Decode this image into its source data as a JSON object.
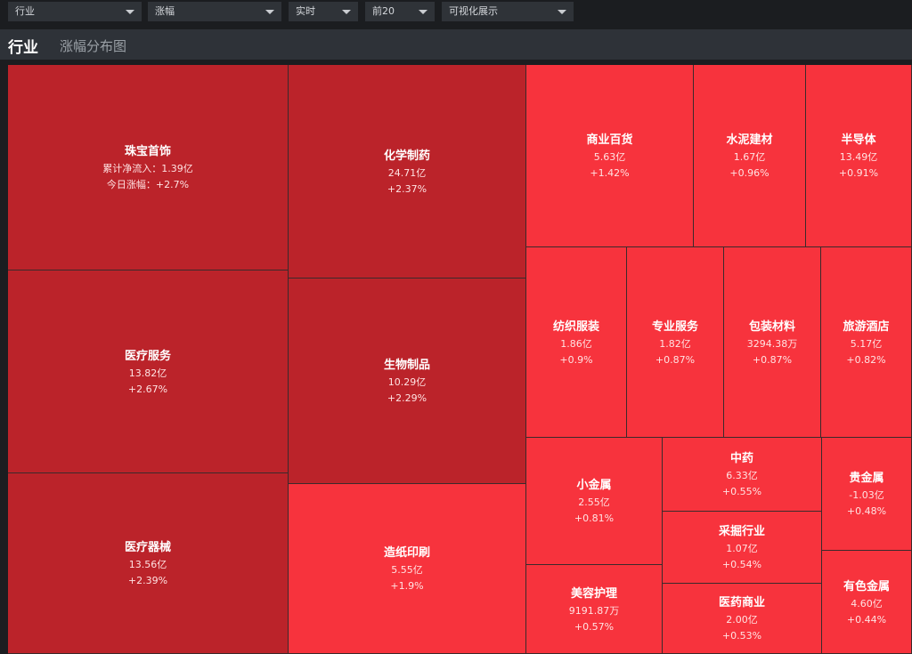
{
  "toolbar": {
    "selects": [
      {
        "value": "行业"
      },
      {
        "value": "涨幅"
      },
      {
        "value": "实时"
      },
      {
        "value": "前20"
      },
      {
        "value": "可视化展示"
      }
    ]
  },
  "header": {
    "title": "行业",
    "subtitle": "涨幅分布图"
  },
  "colors": {
    "dark_tile": "#bb232a",
    "bright_tile": "#f7333d",
    "background": "#1b1d20",
    "title_bar": "#2e3238"
  },
  "treemap": {
    "items": [
      {
        "name": "珠宝首饰",
        "flow": "累计净流入：1.39亿",
        "change": "今日涨幅：+2.7%",
        "shade": "dark"
      },
      {
        "name": "化学制药",
        "flow": "24.71亿",
        "change": "+2.37%",
        "shade": "dark"
      },
      {
        "name": "医疗服务",
        "flow": "13.82亿",
        "change": "+2.67%",
        "shade": "dark"
      },
      {
        "name": "生物制品",
        "flow": "10.29亿",
        "change": "+2.29%",
        "shade": "dark"
      },
      {
        "name": "医疗器械",
        "flow": "13.56亿",
        "change": "+2.39%",
        "shade": "dark"
      },
      {
        "name": "造纸印刷",
        "flow": "5.55亿",
        "change": "+1.9%",
        "shade": "bright"
      },
      {
        "name": "商业百货",
        "flow": "5.63亿",
        "change": "+1.42%",
        "shade": "bright"
      },
      {
        "name": "水泥建材",
        "flow": "1.67亿",
        "change": "+0.96%",
        "shade": "bright"
      },
      {
        "name": "半导体",
        "flow": "13.49亿",
        "change": "+0.91%",
        "shade": "bright"
      },
      {
        "name": "纺织服装",
        "flow": "1.86亿",
        "change": "+0.9%",
        "shade": "bright"
      },
      {
        "name": "专业服务",
        "flow": "1.82亿",
        "change": "+0.87%",
        "shade": "bright"
      },
      {
        "name": "包装材料",
        "flow": "3294.38万",
        "change": "+0.87%",
        "shade": "bright"
      },
      {
        "name": "旅游酒店",
        "flow": "5.17亿",
        "change": "+0.82%",
        "shade": "bright"
      },
      {
        "name": "小金属",
        "flow": "2.55亿",
        "change": "+0.81%",
        "shade": "bright"
      },
      {
        "name": "中药",
        "flow": "6.33亿",
        "change": "+0.55%",
        "shade": "bright"
      },
      {
        "name": "贵金属",
        "flow": "-1.03亿",
        "change": "+0.48%",
        "shade": "bright"
      },
      {
        "name": "采掘行业",
        "flow": "1.07亿",
        "change": "+0.54%",
        "shade": "bright"
      },
      {
        "name": "美容护理",
        "flow": "9191.87万",
        "change": "+0.57%",
        "shade": "bright"
      },
      {
        "name": "医药商业",
        "flow": "2.00亿",
        "change": "+0.53%",
        "shade": "bright"
      },
      {
        "name": "有色金属",
        "flow": "4.60亿",
        "change": "+0.44%",
        "shade": "bright"
      }
    ]
  }
}
